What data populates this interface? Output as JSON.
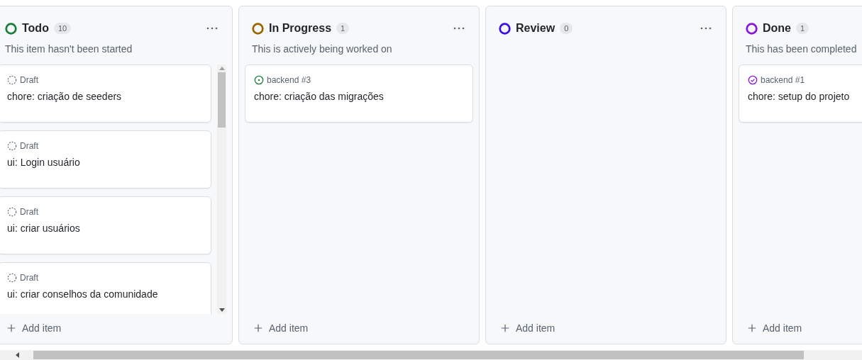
{
  "columns": [
    {
      "title": "Todo",
      "count": "10",
      "color": "#1a7f37",
      "description": "This item hasn't been started",
      "scrollable": true,
      "cards": [
        {
          "kind": "draft",
          "meta": "Draft",
          "title": "chore: criação de seeders"
        },
        {
          "kind": "draft",
          "meta": "Draft",
          "title": "ui: Login usuário"
        },
        {
          "kind": "draft",
          "meta": "Draft",
          "title": "ui: criar usuários"
        },
        {
          "kind": "draft",
          "meta": "Draft",
          "title": "ui: criar conselhos da comunidade"
        }
      ],
      "add_label": "Add item"
    },
    {
      "title": "In Progress",
      "count": "1",
      "color": "#9a6700",
      "description": "This is actively being worked on",
      "scrollable": false,
      "cards": [
        {
          "kind": "open",
          "meta": "backend #3",
          "title": "chore: criação das migrações"
        }
      ],
      "add_label": "Add item"
    },
    {
      "title": "Review",
      "count": "0",
      "color": "#3b10e0",
      "scrollable": false,
      "add_label": "Add item"
    },
    {
      "title": "Done",
      "count": "1",
      "color": "#8a16d8",
      "description": "This has been completed",
      "scrollable": false,
      "cards": [
        {
          "kind": "closed",
          "meta": "backend #1",
          "title": "chore: setup do projeto"
        }
      ],
      "add_label": "Add item"
    }
  ]
}
